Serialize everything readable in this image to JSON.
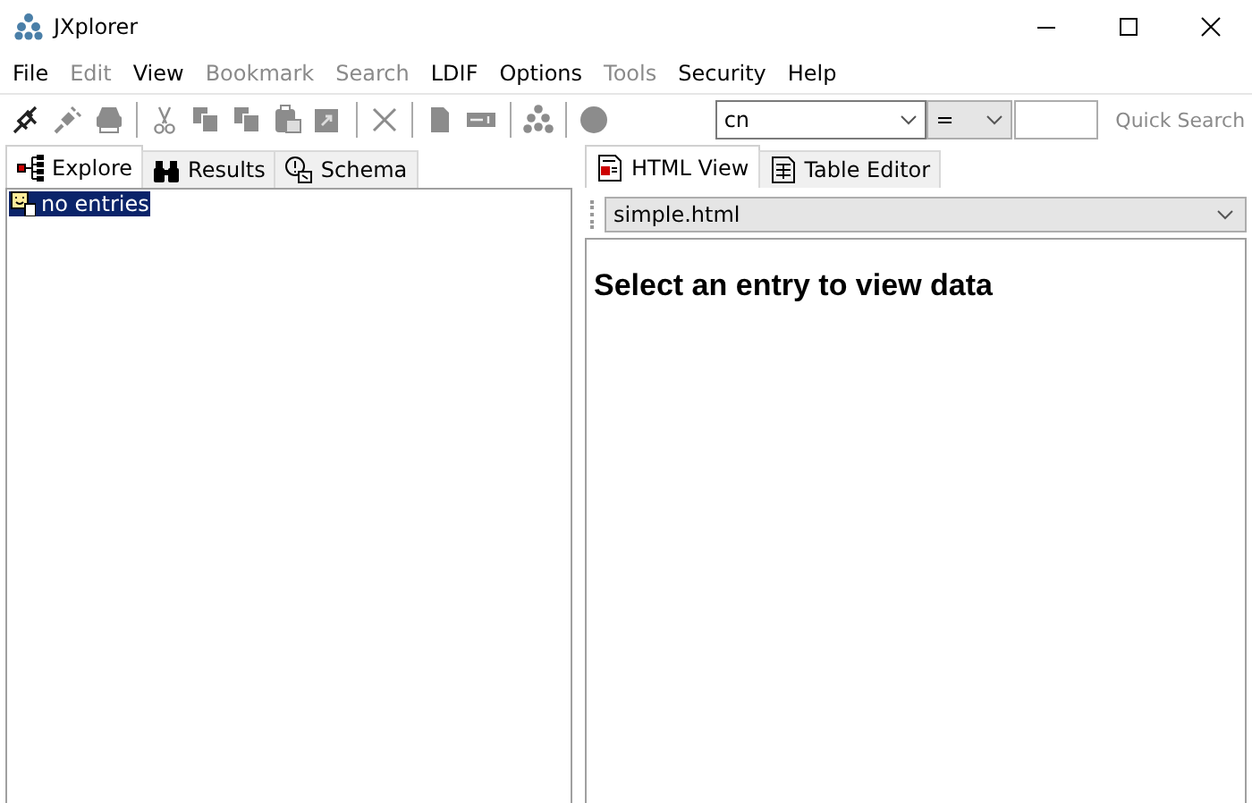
{
  "window": {
    "title": "JXplorer"
  },
  "menu": [
    {
      "label": "File",
      "disabled": false
    },
    {
      "label": "Edit",
      "disabled": true
    },
    {
      "label": "View",
      "disabled": false
    },
    {
      "label": "Bookmark",
      "disabled": true
    },
    {
      "label": "Search",
      "disabled": true
    },
    {
      "label": "LDIF",
      "disabled": false
    },
    {
      "label": "Options",
      "disabled": false
    },
    {
      "label": "Tools",
      "disabled": true
    },
    {
      "label": "Security",
      "disabled": false
    },
    {
      "label": "Help",
      "disabled": false
    }
  ],
  "toolbar": [
    {
      "kind": "connect",
      "disabled": false
    },
    {
      "kind": "disconnect",
      "disabled": true
    },
    {
      "kind": "print",
      "disabled": true
    },
    {
      "kind": "separator"
    },
    {
      "kind": "cut",
      "disabled": true
    },
    {
      "kind": "copy",
      "disabled": true
    },
    {
      "kind": "copy",
      "disabled": true
    },
    {
      "kind": "paste",
      "disabled": true
    },
    {
      "kind": "paste-special",
      "disabled": true
    },
    {
      "kind": "separator"
    },
    {
      "kind": "delete",
      "disabled": true
    },
    {
      "kind": "separator"
    },
    {
      "kind": "new",
      "disabled": true
    },
    {
      "kind": "rename",
      "disabled": true
    },
    {
      "kind": "separator"
    },
    {
      "kind": "refresh",
      "disabled": true
    },
    {
      "kind": "separator"
    },
    {
      "kind": "stop",
      "disabled": true
    }
  ],
  "quick_search": {
    "attribute": "cn",
    "operator": "=",
    "button": {
      "label": "Quick Search",
      "disabled": true
    }
  },
  "left_tabs": [
    {
      "label": "Explore",
      "kind": "tree",
      "selected": true
    },
    {
      "label": "Results",
      "kind": "binoculars",
      "selected": false
    },
    {
      "label": "Schema",
      "kind": "schema",
      "selected": false
    }
  ],
  "tree": [
    {
      "label": "no entries",
      "selected": true
    }
  ],
  "right_tabs": [
    {
      "label": "HTML View",
      "kind": "html",
      "selected": true
    },
    {
      "label": "Table Editor",
      "kind": "table",
      "selected": false
    }
  ],
  "view_selector": "simple.html",
  "message": "Select an entry to view data"
}
